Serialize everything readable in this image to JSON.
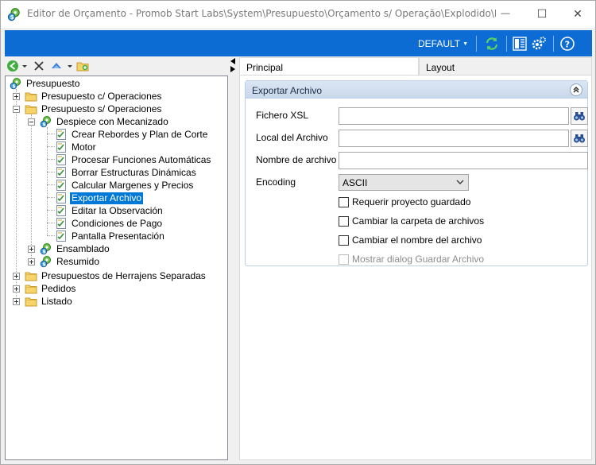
{
  "window": {
    "title": "Editor de Orçamento - Promob Start Labs\\System\\Presupuesto\\Orçamento s/ Operação\\Explodido\\Exportar...",
    "minimize_glyph": "—",
    "maximize_glyph": "☐",
    "close_glyph": "✕"
  },
  "ribbon": {
    "profile": "DEFAULT",
    "accent_color": "#0d6bd4",
    "icons": [
      "refresh-icon",
      "panel-layout-icon",
      "settings-icon",
      "help-icon"
    ]
  },
  "tree_toolbar": {
    "icons": [
      "back-icon",
      "dropdown-caret-icon",
      "delete-icon",
      "move-up-icon",
      "dropdown-caret-icon",
      "add-item-icon"
    ]
  },
  "tree": {
    "root": "Presupuesto",
    "nodes": [
      {
        "label": "Presupuesto c/ Operaciones"
      },
      {
        "label": "Presupuesto s/ Operaciones"
      },
      {
        "label": "Despiece con Mecanizado"
      },
      {
        "label": "Crear Rebordes y Plan de Corte"
      },
      {
        "label": "Motor"
      },
      {
        "label": "Procesar Funciones Automáticas"
      },
      {
        "label": "Borrar Estructuras Dinámicas"
      },
      {
        "label": "Calcular Margenes y Precios"
      },
      {
        "label": "Exportar Archivo"
      },
      {
        "label": "Editar la Observación"
      },
      {
        "label": "Condiciones de Pago"
      },
      {
        "label": "Pantalla Presentación"
      },
      {
        "label": "Ensamblado"
      },
      {
        "label": "Resumido"
      },
      {
        "label": "Presupuestos de Herrajens Separadas"
      },
      {
        "label": "Pedidos"
      },
      {
        "label": "Listado"
      }
    ]
  },
  "tabs": [
    {
      "label": "Principal"
    },
    {
      "label": "Layout"
    }
  ],
  "group": {
    "title": "Exportar Archivo",
    "fields": {
      "xsl_label": "Fichero XSL",
      "xsl_value": "",
      "local_label": "Local del Archivo",
      "local_value": "",
      "name_label": "Nombre de archivo",
      "name_value": "",
      "encoding_label": "Encoding",
      "encoding_value": "ASCII"
    },
    "checkboxes": [
      {
        "label": "Requerir proyecto guardado",
        "checked": false,
        "enabled": true
      },
      {
        "label": "Cambiar la carpeta de archivos",
        "checked": false,
        "enabled": true
      },
      {
        "label": "Cambiar el nombre del archivo",
        "checked": false,
        "enabled": true
      },
      {
        "label": "Mostrar dialog Guardar Archivo",
        "checked": false,
        "enabled": false
      }
    ]
  }
}
